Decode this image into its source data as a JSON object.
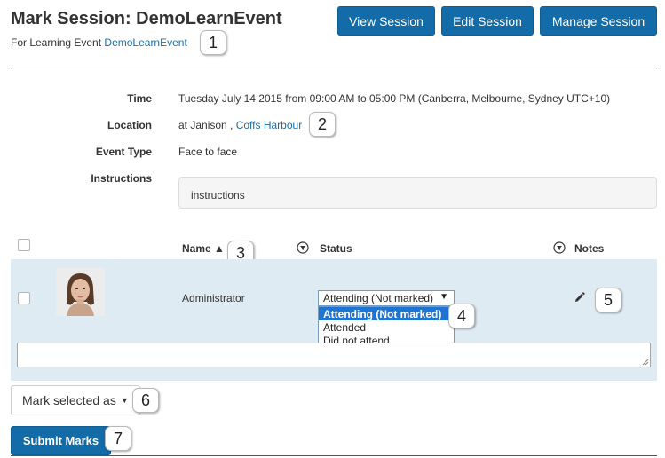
{
  "header": {
    "title": "Mark Session: DemoLearnEvent",
    "subtitle_prefix": "For Learning Event",
    "event_link": "DemoLearnEvent",
    "buttons": {
      "view": "View Session",
      "edit": "Edit Session",
      "manage": "Manage Session"
    }
  },
  "details": {
    "time_label": "Time",
    "time_value": "Tuesday July 14 2015 from 09:00 AM to 05:00 PM (Canberra, Melbourne, Sydney UTC+10)",
    "location_label": "Location",
    "location_prefix": "at Janison ,",
    "location_link": "Coffs Harbour",
    "event_type_label": "Event Type",
    "event_type_value": "Face to face",
    "instructions_label": "Instructions",
    "instructions_value": "instructions"
  },
  "table": {
    "columns": {
      "name": "Name ▲",
      "status": "Status",
      "notes": "Notes"
    },
    "rows": [
      {
        "name": "Administrator",
        "status_selected": "Attending (Not marked)",
        "status_options": [
          "Attending (Not marked)",
          "Attended",
          "Did not attend"
        ]
      }
    ]
  },
  "actions": {
    "mark_selected": "Mark selected as",
    "submit": "Submit Marks"
  },
  "callouts": [
    "1",
    "2",
    "3",
    "4",
    "5",
    "6",
    "7"
  ],
  "colors": {
    "primary_button": "#136ba8",
    "link": "#1a6ea8",
    "row_highlight": "#deebf3",
    "dropdown_selected": "#1e74d0"
  },
  "icons": [
    "filter-icon",
    "pencil-icon",
    "caret-down-icon",
    "sort-ascending-icon",
    "resize-grip-icon"
  ]
}
